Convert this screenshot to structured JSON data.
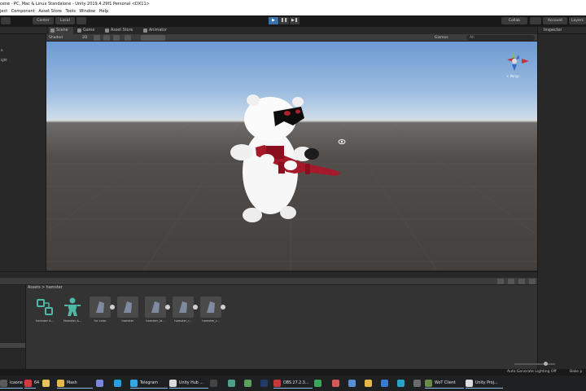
{
  "window": {
    "title": "cene - PC, Mac & Linux Standalone - Unity 2019.4.29f1 Personal <DX11>"
  },
  "menu": {
    "items": [
      "ject",
      "Component",
      "Asset Store",
      "Tools",
      "Window",
      "Help"
    ]
  },
  "toolbar": {
    "left_button": "Center",
    "left_button2": "Local",
    "play_icon": "▶",
    "pause_icon": "❚❚",
    "step_icon": "▶❚",
    "collab_label": "Collab",
    "account_label": "Account",
    "layers_label": "Layers",
    "layout_label": "Layout"
  },
  "scene_tabs": [
    {
      "label": "Scene",
      "icon": "hash-icon"
    },
    {
      "label": "Game",
      "icon": "gamepad-icon"
    },
    {
      "label": "Asset Store",
      "icon": "store-icon"
    },
    {
      "label": "Animator",
      "icon": "animator-icon"
    }
  ],
  "scene_toolbar": {
    "shading_mode": "Shaded",
    "mode_2d": "2D",
    "gizmos_label": "Gizmos",
    "search_placeholder": "All"
  },
  "gizmo": {
    "persp_label": "< Persp"
  },
  "left_panel": {
    "items": [
      "",
      "e",
      "ight"
    ]
  },
  "right_panel": {
    "tab_label": "Inspector"
  },
  "project": {
    "breadcrumb": "Assets  >  hamster",
    "assets": [
      {
        "label": "hamster A...",
        "icon": "animator-controller-icon",
        "has_arrow": false
      },
      {
        "label": "Hamster A...",
        "icon": "avatar-icon",
        "has_arrow": false
      },
      {
        "label": "fur color",
        "icon": "model-icon",
        "has_arrow": true
      },
      {
        "label": "hamster",
        "icon": "model-icon",
        "has_arrow": false
      },
      {
        "label": "hamster_id...",
        "icon": "model-icon",
        "has_arrow": true
      },
      {
        "label": "hamster_r...",
        "icon": "model-icon",
        "has_arrow": true
      },
      {
        "label": "hamster_r...",
        "icon": "model-icon",
        "has_arrow": true
      }
    ]
  },
  "status": {
    "text": "Auto Generate Lighting Off",
    "right": "Bake p"
  },
  "taskbar": {
    "items": [
      {
        "label": "icaone -",
        "icon": "app-icon",
        "color": "#5a5a5a"
      },
      {
        "label": "64",
        "icon": "badge-icon",
        "color": "#d23b3b"
      },
      {
        "label": "",
        "icon": "file-icon",
        "color": "#e8c25a"
      },
      {
        "label": "Mash",
        "icon": "folder-icon",
        "color": "#e8b84a"
      },
      {
        "label": "",
        "icon": "discord-icon",
        "color": "#7b86e2"
      },
      {
        "label": "",
        "icon": "skype-icon",
        "color": "#2b9de0"
      },
      {
        "label": "Telegram",
        "icon": "telegram-icon",
        "color": "#35a7e0"
      },
      {
        "label": "Unity Hub ...",
        "icon": "unity-hub-icon",
        "color": "#dddddd"
      },
      {
        "label": "",
        "icon": "app-icon",
        "color": "#444444"
      },
      {
        "label": "",
        "icon": "app-icon",
        "color": "#4f9f8a"
      },
      {
        "label": "",
        "icon": "app-icon",
        "color": "#5aa25a"
      },
      {
        "label": "",
        "icon": "photoshop-icon",
        "color": "#223a6a"
      },
      {
        "label": "OBS 27.2.3...",
        "icon": "obs-icon",
        "color": "#c23a3a"
      },
      {
        "label": "",
        "icon": "app-icon",
        "color": "#3aa65a"
      },
      {
        "label": "",
        "icon": "app-icon",
        "color": "#d25a5a"
      },
      {
        "label": "",
        "icon": "app-icon",
        "color": "#5a8fd2"
      },
      {
        "label": "",
        "icon": "chrome-icon",
        "color": "#e6b84a"
      },
      {
        "label": "",
        "icon": "app-icon",
        "color": "#3a7ad2"
      },
      {
        "label": "",
        "icon": "edge-icon",
        "color": "#2aa2c8"
      },
      {
        "label": "",
        "icon": "app-icon",
        "color": "#6a6a6a"
      },
      {
        "label": "WoT Client",
        "icon": "wot-icon",
        "color": "#6a8a4a"
      },
      {
        "label": "Unity Proj...",
        "icon": "unity-icon",
        "color": "#dddddd"
      }
    ]
  }
}
